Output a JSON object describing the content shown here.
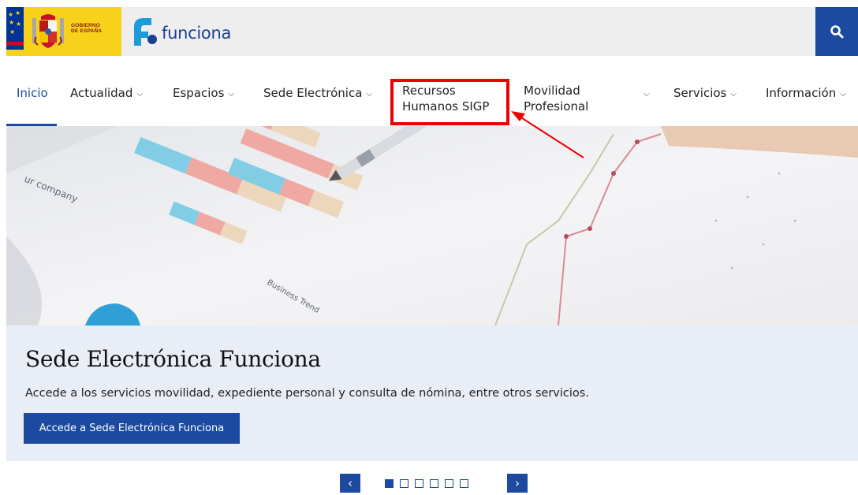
{
  "header": {
    "gov_text_line1": "GOBIERNO",
    "gov_text_line2": "DE ESPAÑA",
    "site_name": "funciona",
    "search_icon": "search-icon"
  },
  "nav": {
    "items": [
      {
        "label": "Inicio",
        "active": true
      },
      {
        "label": "Actualidad",
        "dropdown": true
      },
      {
        "label": "Espacios",
        "dropdown": true
      },
      {
        "label": "Sede Electrónica",
        "dropdown": true
      },
      {
        "label_line1": "Recursos",
        "label_line2": "Humanos SIGP",
        "highlighted": true
      },
      {
        "label_line1": "Movilidad",
        "label_line2": "Profesional",
        "dropdown": true
      },
      {
        "label": "Servicios",
        "dropdown": true
      },
      {
        "label": "Información",
        "dropdown": true
      }
    ],
    "chevron_glyph": "⌄"
  },
  "hero": {
    "chart_text_1": "ur company",
    "chart_text_2": "Business Trend"
  },
  "slide": {
    "title": "Sede Electrónica Funciona",
    "description": "Accede a los servicios movilidad, expediente personal y consulta de nómina, entre otros servicios.",
    "button_label": "Accede a Sede Electrónica Funciona"
  },
  "pager": {
    "prev_glyph": "‹",
    "next_glyph": "›",
    "total_slides": 6,
    "current_slide": 1
  },
  "colors": {
    "primary": "#1b4aa0",
    "gov_yellow": "#f8d21a",
    "highlight_red": "#ee0000",
    "caption_bg": "#e8edf6"
  }
}
